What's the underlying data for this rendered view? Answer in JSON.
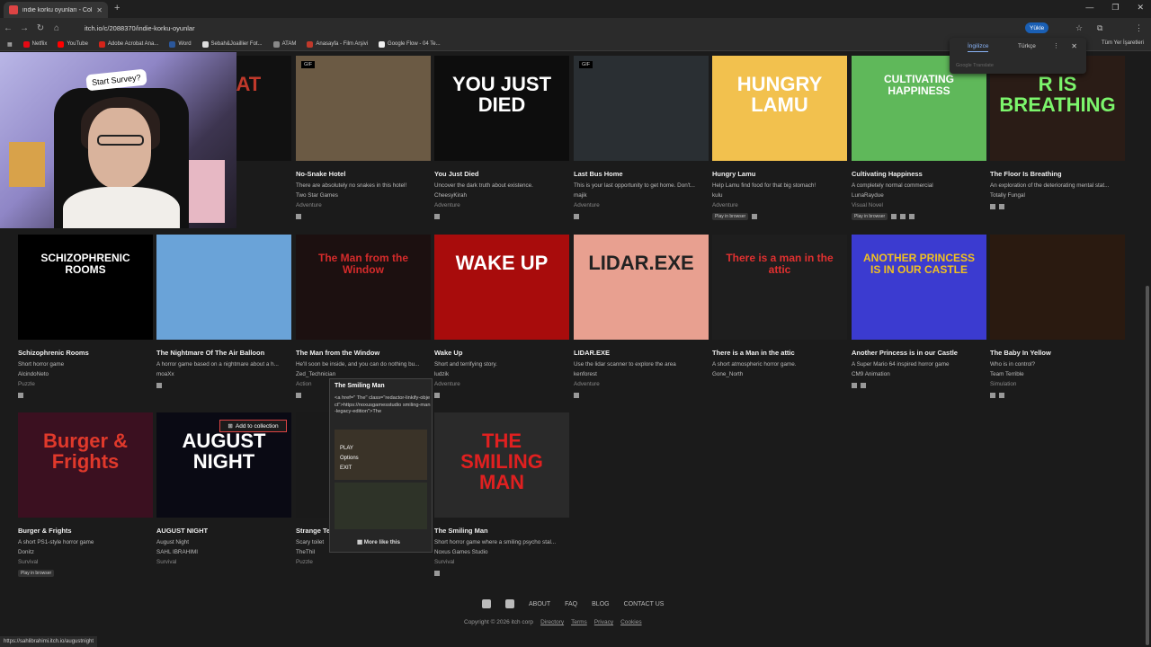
{
  "browser": {
    "tab_title": "indie korku oyunları - Collection",
    "url": "itch.io/c/2088370/indie-korku-oyunlar",
    "upload_label": "Yükle",
    "bookmarks": [
      {
        "label": "Netflix",
        "color": "#e50914"
      },
      {
        "label": "YouTube",
        "color": "#ff0000"
      },
      {
        "label": "Adobe Acrobat Ana...",
        "color": "#d4241a"
      },
      {
        "label": "Word",
        "color": "#2b579a"
      },
      {
        "label": "Sebah&Joaillier Fot...",
        "color": "#dddddd"
      },
      {
        "label": "ATAM",
        "color": "#888888"
      },
      {
        "label": "Anasayfa - Film Arşivi",
        "color": "#c0392b"
      },
      {
        "label": "Google Flow - 04 Te...",
        "color": "#eeeeee"
      }
    ],
    "all_bookmarks": "Tüm Yer İşaretleri",
    "status_url": "https://sahlibrahimi.itch.io/augustnight"
  },
  "translate": {
    "lang_from": "İngilizce",
    "lang_to": "Türkçe",
    "brand": "Google Translate"
  },
  "webcam": {
    "sign_text": "Start Survey?"
  },
  "games": [
    {
      "title": "Jlleyway",
      "desc": "e punch some pe...",
      "author": "",
      "genre": "",
      "thumb_text": "MY CAT",
      "thumb_color": "#c0392b",
      "bg": "#111111",
      "platforms": []
    },
    {
      "title": "No-Snake Hotel",
      "desc": "There are absolutely no snakes in this hotel!",
      "author": "Two Star Games",
      "genre": "Adventure",
      "thumb_text": "",
      "thumb_color": "#ffffff",
      "bg": "#6b5a44",
      "gif": "GIF",
      "platforms": [
        "win"
      ]
    },
    {
      "title": "You Just Died",
      "desc": "Uncover the dark truth about existence.",
      "author": "CheesyKirah",
      "genre": "Adventure",
      "thumb_text": "YOU JUST DIED",
      "thumb_color": "#ffffff",
      "bg": "#0d0d0d",
      "platforms": [
        "win"
      ]
    },
    {
      "title": "Last Bus Home",
      "desc": "This is your last opportunity to get home. Don't...",
      "author": "majik",
      "genre": "Adventure",
      "thumb_text": "",
      "thumb_color": "#ffffff",
      "bg": "#2a2f33",
      "gif": "GIF",
      "platforms": [
        "win"
      ]
    },
    {
      "title": "Hungry Lamu",
      "desc": "Help Lamu find food for that big stomach!",
      "author": "kulu",
      "genre": "Adventure",
      "thumb_text": "HUNGRY LAMU",
      "thumb_color": "#ffffff",
      "bg": "#f2c14e",
      "platforms": [
        "browser",
        "win"
      ]
    },
    {
      "title": "Cultivating Happiness",
      "desc": "A completely normal commercial",
      "author": "LunaRaydue",
      "genre": "Visual Novel",
      "thumb_text": "CULTIVATING HAPPINESS",
      "thumb_color": "#ffffff",
      "bg": "#5fb85a",
      "platforms": [
        "browser",
        "win",
        "linux",
        "mac"
      ]
    },
    {
      "title": "The Floor Is Breathing",
      "desc": "An exploration of the deteriorating mental stat...",
      "author": "Totally Fungal",
      "genre": "",
      "thumb_text": "R IS BREATHING",
      "thumb_color": "#7cf56c",
      "bg": "#2a1c16",
      "platforms": [
        "win",
        "linux"
      ]
    },
    {
      "title": "Schizophrenic Rooms",
      "desc": "Short horror game",
      "author": "AlcindoNeto",
      "genre": "Puzzle",
      "thumb_text": "SCHIZOPHRENIC ROOMS",
      "thumb_color": "#ffffff",
      "bg": "#000000",
      "platforms": [
        "win"
      ]
    },
    {
      "title": "The Nightmare Of The Air Balloon",
      "desc": "A horror game based on a nightmare about a h...",
      "author": "moaXx",
      "genre": "",
      "thumb_text": "",
      "thumb_color": "#ffffff",
      "bg": "#6aa3d8",
      "platforms": [
        "win"
      ]
    },
    {
      "title": "The Man from the Window",
      "desc": "He'll soon be inside, and you can do nothing bu...",
      "author": "Zed_Technician",
      "genre": "Action",
      "thumb_text": "The Man from the Window",
      "thumb_color": "#d42b2b",
      "bg": "#1c1010",
      "platforms": [
        "win"
      ]
    },
    {
      "title": "Wake Up",
      "desc": "Short and terrifying story.",
      "author": "ludzik",
      "genre": "Adventure",
      "thumb_text": "WAKE UP",
      "thumb_color": "#ffffff",
      "bg": "#a80c0c",
      "platforms": [
        "win"
      ]
    },
    {
      "title": "LIDAR.EXE",
      "desc": "Use the lidar scanner to explore the area",
      "author": "kenforest",
      "genre": "Adventure",
      "thumb_text": "LIDAR.EXE",
      "thumb_color": "#222222",
      "bg": "#e8a090",
      "platforms": [
        "win"
      ]
    },
    {
      "title": "There is a Man in the attic",
      "desc": "A short atmospheric horror game.",
      "author": "Gone_North",
      "genre": "",
      "thumb_text": "There is a man in the attic",
      "thumb_color": "#e03030",
      "bg": "#1e1e1e",
      "platforms": []
    },
    {
      "title": "Another Princess is in our Castle",
      "desc": "A Super Mario 64 inspired horror game",
      "author": "CM9 Animation",
      "genre": "",
      "thumb_text": "ANOTHER PRINCESS IS IN OUR CASTLE",
      "thumb_color": "#f0c020",
      "bg": "#3b3bd0",
      "platforms": [
        "win",
        "mac"
      ]
    },
    {
      "title": "The Baby In Yellow",
      "desc": "Who is in control?",
      "author": "Team Terrible",
      "genre": "Simulation",
      "thumb_text": "",
      "thumb_color": "#ffffff",
      "bg": "#2a1a10",
      "platforms": [
        "win",
        "android"
      ]
    },
    {
      "title": "Burger & Frights",
      "desc": "A short PS1-style horror game",
      "author": "Donitz",
      "genre": "Survival",
      "thumb_text": "Burger & Frights",
      "thumb_color": "#e0392b",
      "bg": "#3b1020",
      "platforms": [
        "browser"
      ]
    },
    {
      "title": "AUGUST NIGHT",
      "desc": "August Night",
      "author": "SAHL IBRAHIMI",
      "genre": "Survival",
      "thumb_text": "AUGUST NIGHT",
      "thumb_color": "#ffffff",
      "bg": "#0a0a14",
      "platforms": []
    },
    {
      "title": "Strange Te",
      "desc": "Scary toilet",
      "author": "TheThil",
      "genre": "Puzzle",
      "thumb_text": "",
      "thumb_color": "#ffffff",
      "bg": "#1a1a1a",
      "platforms": []
    },
    {
      "title": "The Smiling Man",
      "desc": "Short horror game where a smiling psycho stal...",
      "author": "Noxus Games Studio",
      "genre": "Survival",
      "thumb_text": "THE SMILING MAN",
      "thumb_color": "#e02020",
      "bg": "#2a2a2a",
      "platforms": [
        "win"
      ]
    }
  ],
  "popup": {
    "title": "The Smiling Man",
    "text": "<a href=\" The\" class=\"redactor-linkify-object\">https://noxusgamesstudio smiling-man-legacy-edition\">The",
    "menu": [
      "PLAY",
      "Options",
      "EXIT"
    ],
    "more_label": "More like this"
  },
  "add_collection_label": "Add to collection",
  "footer": {
    "links": [
      "ABOUT",
      "FAQ",
      "BLOG",
      "CONTACT US"
    ],
    "copyright": "Copyright © 2026 itch corp",
    "legal": [
      "Directory",
      "Terms",
      "Privacy",
      "Cookies"
    ]
  }
}
